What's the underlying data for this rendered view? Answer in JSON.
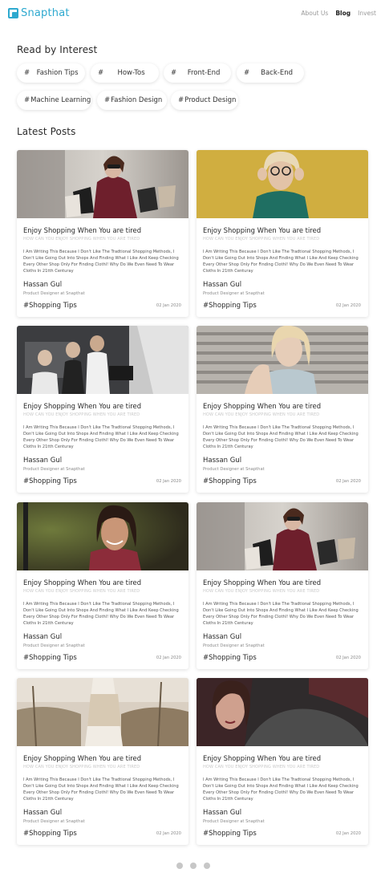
{
  "nav": {
    "logo_text": "Snapthat",
    "links": [
      "About Us",
      "Blog",
      "Invest"
    ]
  },
  "interest": {
    "title": "Read by Interest",
    "chips": [
      {
        "hash": "#",
        "label": "Fashion Tips"
      },
      {
        "hash": "#",
        "label": "How-Tos"
      },
      {
        "hash": "#",
        "label": "Front-End"
      },
      {
        "hash": "#",
        "label": "Back-End"
      },
      {
        "hash": "#",
        "label": "Machine Learning"
      },
      {
        "hash": "#",
        "label": "Fashion Design"
      },
      {
        "hash": "#",
        "label": "Product Design"
      }
    ]
  },
  "latest": {
    "title": "Latest Posts",
    "posts": [
      {
        "title": "Enjoy Shopping When You are tired",
        "subtitle": "HOW CAN YOU ENJOY SHOPPING WHEN YOU ARE TIRED",
        "body": "I Am Writing This Because I Don't Like The Tradtional Shopping Methods, I Don't Like Going Out Into Shops And Finding What I Like And Keep Checking Every Other Shop Only For Finding Clothl! Why Do We Even Need To Wear Cloths In 21tth Centuray",
        "author": "Hassan Gul",
        "role": "Product Designer at Snapthat",
        "tag": "#Shopping Tips",
        "date": "02 Jan 2020"
      },
      {
        "title": "Enjoy Shopping When You are tired",
        "subtitle": "HOW CAN YOU ENJOY SHOPPING WHEN YOU ARE TIRED",
        "body": "I Am Writing This Because I Don't Like The Tradtional Shopping Methods, I Don't Like Going Out Into Shops And Finding What I Like And Keep Checking Every Other Shop Only For Finding Clothl! Why Do We Even Need To Wear Cloths In 21tth Centuray",
        "author": "Hassan Gul",
        "role": "Product Designer at Snapthat",
        "tag": "#Shopping Tips",
        "date": "02 Jan 2020"
      },
      {
        "title": "Enjoy Shopping When You are tired",
        "subtitle": "HOW CAN YOU ENJOY SHOPPING WHEN YOU ARE TIRED",
        "body": "I Am Writing This Because I Don't Like The Tradtional Shopping Methods, I Don't Like Going Out Into Shops And Finding What I Like And Keep Checking Every Other Shop Only For Finding Clothl! Why Do We Even Need To Wear Cloths In 21tth Centuray",
        "author": "Hassan Gul",
        "role": "Product Designer at Snapthat",
        "tag": "#Shopping Tips",
        "date": "02 Jan 2020"
      },
      {
        "title": "Enjoy Shopping When You are tired",
        "subtitle": "HOW CAN YOU ENJOY SHOPPING WHEN YOU ARE TIRED",
        "body": "I Am Writing This Because I Don't Like The Tradtional Shopping Methods, I Don't Like Going Out Into Shops And Finding What I Like And Keep Checking Every Other Shop Only For Finding Clothl! Why Do We Even Need To Wear Cloths In 21tth Centuray",
        "author": "Hassan Gul",
        "role": "Product Designer at Snapthat",
        "tag": "#Shopping Tips",
        "date": "02 Jan 2020"
      },
      {
        "title": "Enjoy Shopping When You are tired",
        "subtitle": "HOW CAN YOU ENJOY SHOPPING WHEN YOU ARE TIRED",
        "body": "I Am Writing This Because I Don't Like The Tradtional Shopping Methods, I Don't Like Going Out Into Shops And Finding What I Like And Keep Checking Every Other Shop Only For Finding Clothl! Why Do We Even Need To Wear Cloths In 21tth Centuray",
        "author": "Hassan Gul",
        "role": "Product Designer at Snapthat",
        "tag": "#Shopping Tips",
        "date": "02 Jan 2020"
      },
      {
        "title": "Enjoy Shopping When You are tired",
        "subtitle": "HOW CAN YOU ENJOY SHOPPING WHEN YOU ARE TIRED",
        "body": "I Am Writing This Because I Don't Like The Tradtional Shopping Methods, I Don't Like Going Out Into Shops And Finding What I Like And Keep Checking Every Other Shop Only For Finding Clothl! Why Do We Even Need To Wear Cloths In 21tth Centuray",
        "author": "Hassan Gul",
        "role": "Product Designer at Snapthat",
        "tag": "#Shopping Tips",
        "date": "02 Jan 2020"
      },
      {
        "title": "Enjoy Shopping When You are tired",
        "subtitle": "HOW CAN YOU ENJOY SHOPPING WHEN YOU ARE TIRED",
        "body": "I Am Writing This Because I Don't Like The Tradtional Shopping Methods, I Don't Like Going Out Into Shops And Finding What I Like And Keep Checking Every Other Shop Only For Finding Clothl! Why Do We Even Need To Wear Cloths In 21tth Centuray",
        "author": "Hassan Gul",
        "role": "Product Designer at Snapthat",
        "tag": "#Shopping Tips",
        "date": "02 Jan 2020"
      },
      {
        "title": "Enjoy Shopping When You are tired",
        "subtitle": "HOW CAN YOU ENJOY SHOPPING WHEN YOU ARE TIRED",
        "body": "I Am Writing This Because I Don't Like The Tradtional Shopping Methods, I Don't Like Going Out Into Shops And Finding What I Like And Keep Checking Every Other Shop Only For Finding Clothl! Why Do We Even Need To Wear Cloths In 21tth Centuray",
        "author": "Hassan Gul",
        "role": "Product Designer at Snapthat",
        "tag": "#Shopping Tips",
        "date": "02 Jan 2020"
      }
    ]
  },
  "pagination": {
    "pages": 3
  },
  "colors": {
    "brand": "#2ea9cf",
    "dot": "#c7c7c7"
  }
}
